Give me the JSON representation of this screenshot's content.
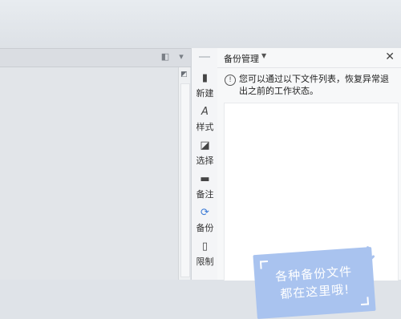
{
  "toolbar": {
    "items": [
      {
        "label": "新建",
        "icon": "new-document-icon"
      },
      {
        "label": "样式",
        "icon": "style-icon"
      },
      {
        "label": "选择",
        "icon": "select-icon"
      },
      {
        "label": "备注",
        "icon": "comment-icon"
      },
      {
        "label": "备份",
        "icon": "backup-icon"
      },
      {
        "label": "限制",
        "icon": "restrict-icon"
      }
    ]
  },
  "panel": {
    "title": "备份管理",
    "info": "您可以通过以下文件列表，恢复异常退出之前的工作状态。",
    "note_line1": "各种备份文件",
    "note_line2": "都在这里哦!"
  },
  "colors": {
    "accent": "#3c7bd6",
    "note": "#a9c3ef"
  }
}
